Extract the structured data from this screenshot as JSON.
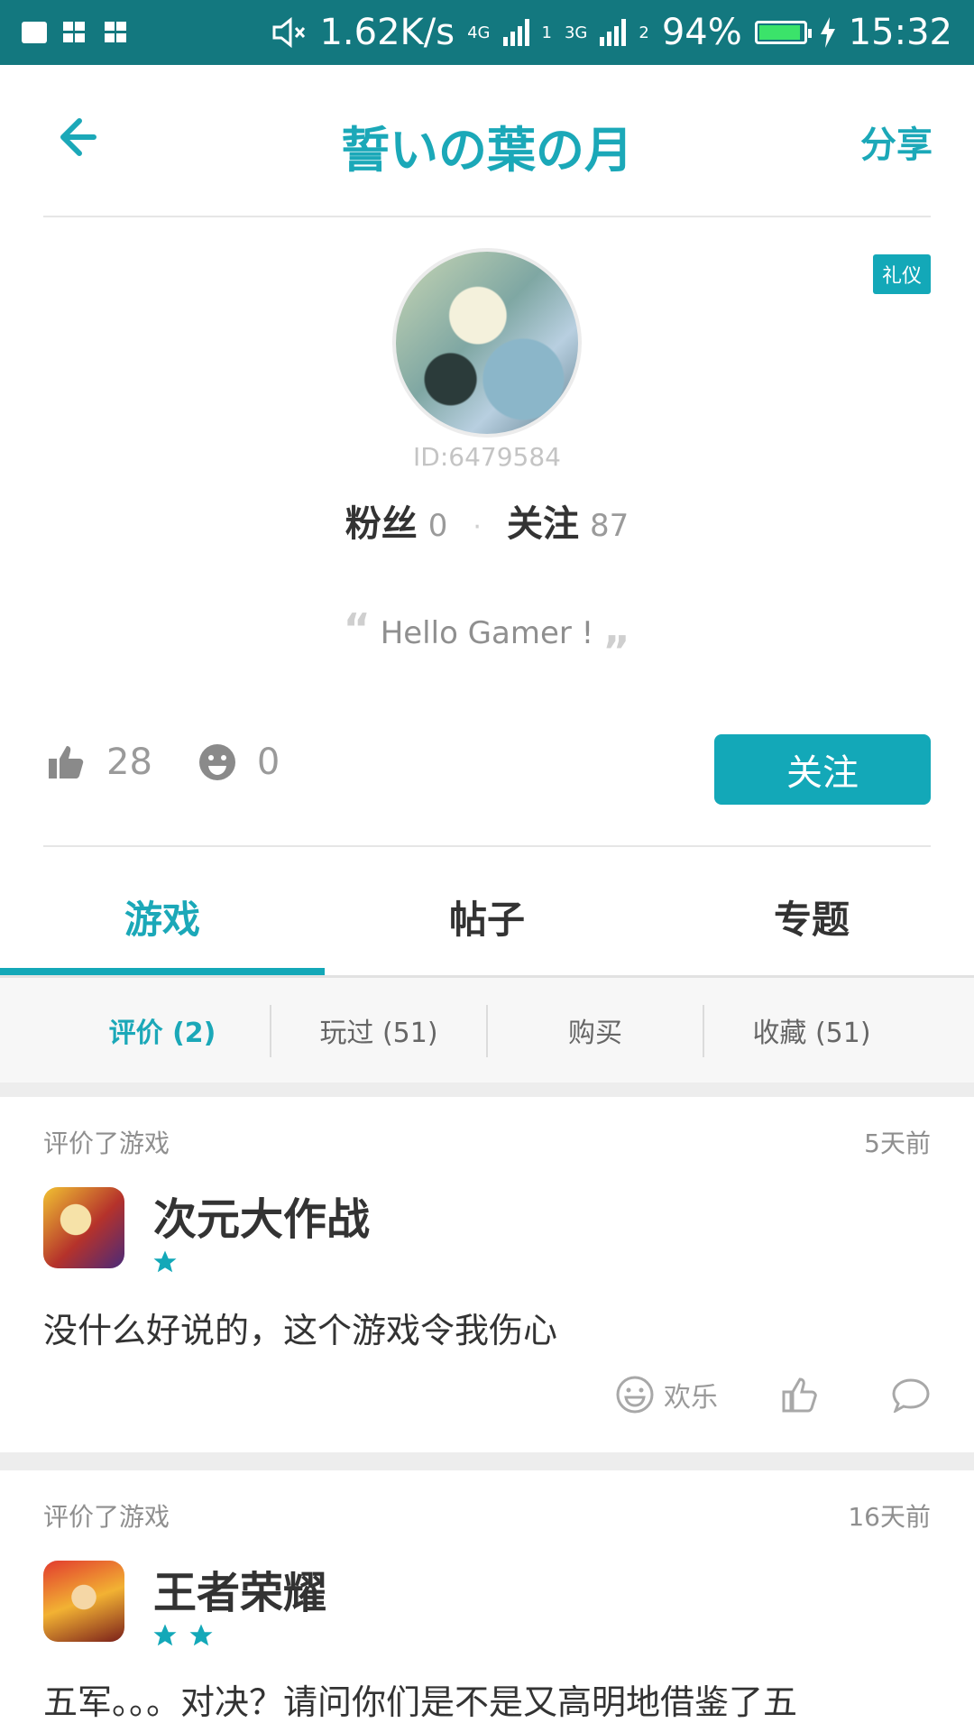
{
  "status_bar": {
    "speed": "1.62K/s",
    "net1": "4G",
    "sim1": "1",
    "net2": "3G",
    "sim2": "2",
    "battery": "94%",
    "battery_level": 0.94,
    "time": "15:32"
  },
  "header": {
    "title": "誓いの葉の月",
    "share": "分享"
  },
  "profile": {
    "badge": "礼仪",
    "user_id": "ID:6479584",
    "fans_label": "粉丝",
    "fans_count": "0",
    "follow_label": "关注",
    "follow_count": "87",
    "quote": "Hello Gamer !",
    "likes": "28",
    "funny": "0",
    "follow_button": "关注"
  },
  "tabs": [
    "游戏",
    "帖子",
    "专题"
  ],
  "active_tab": 0,
  "subtabs": [
    "评价 (2)",
    "玩过 (51)",
    "购买",
    "收藏 (51)"
  ],
  "active_subtab": 0,
  "reviews": [
    {
      "meta": "评价了游戏",
      "time": "5天前",
      "game": "次元大作战",
      "stars": 1,
      "text": "没什么好说的，这个游戏令我伤心",
      "reaction_label": "欢乐"
    },
    {
      "meta": "评价了游戏",
      "time": "16天前",
      "game": "王者荣耀",
      "stars": 2,
      "text": "五军。。。对决？请问你们是不是又高明地借鉴了五"
    }
  ],
  "colors": {
    "accent": "#13a8b8",
    "status_bar": "#13787f"
  }
}
